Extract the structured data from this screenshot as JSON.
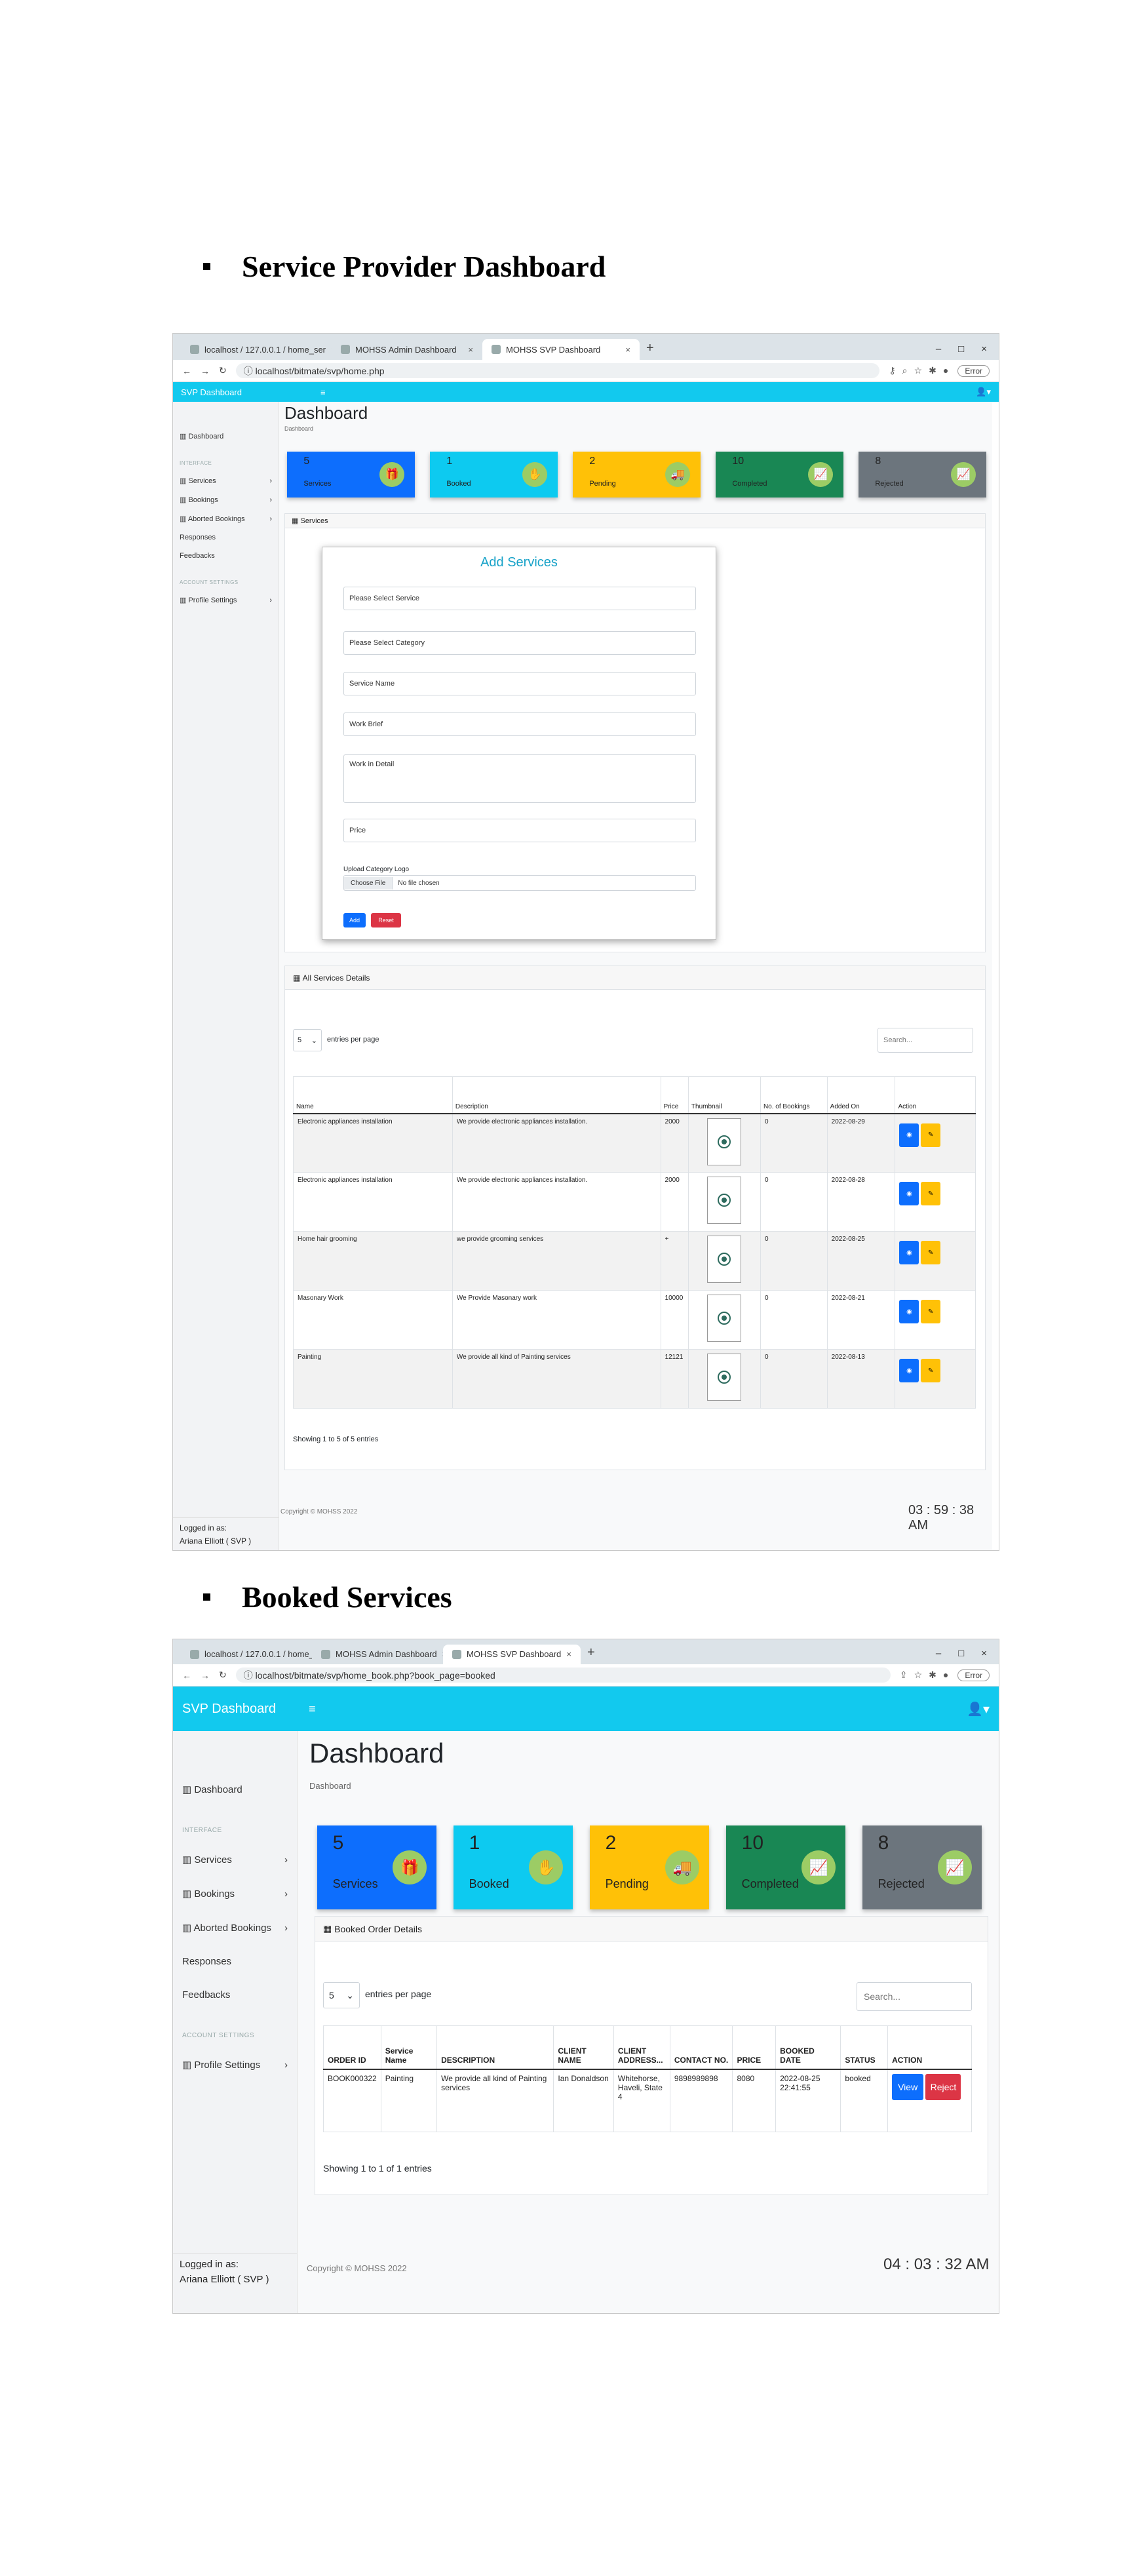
{
  "sections": [
    {
      "title": "Service Provider Dashboard"
    },
    {
      "title": "Booked Services"
    }
  ],
  "shot1": {
    "tabs": [
      "localhost / 127.0.0.1 / home_ser",
      "MOHSS Admin Dashboard",
      "MOHSS SVP Dashboard"
    ],
    "url": "localhost/bitmate/svp/home.php",
    "error_label": "Error",
    "brand": "SVP Dashboard",
    "menu_toggle": "≡",
    "user_icon": "person-icon",
    "sidebar": {
      "dashboard": "Dashboard",
      "interface_label": "INTERFACE",
      "items": [
        "Services",
        "Bookings",
        "Aborted Bookings",
        "Responses",
        "Feedbacks"
      ],
      "account_label": "ACCOUNT SETTINGS",
      "profile": "Profile Settings",
      "logged_in": "Logged in as:",
      "user": "Ariana Elliott ( SVP )"
    },
    "page_title": "Dashboard",
    "breadcrumb": "Dashboard",
    "cards": [
      {
        "num": "5",
        "label": "Services",
        "icon": "gift-icon",
        "color": "#0d6efd"
      },
      {
        "num": "1",
        "label": "Booked",
        "icon": "hand-coin-icon",
        "color": "#0dcaf0"
      },
      {
        "num": "2",
        "label": "Pending",
        "icon": "truck-icon",
        "color": "#ffc107"
      },
      {
        "num": "10",
        "label": "Completed",
        "icon": "chart-line-icon",
        "color": "#198754"
      },
      {
        "num": "8",
        "label": "Rejected",
        "icon": "chart-line-icon",
        "color": "#6c757d"
      }
    ],
    "services_panel_title": "Services",
    "form": {
      "title": "Add Services",
      "service_placeholder": "Please Select Service",
      "category_placeholder": "Please Select Category",
      "name_placeholder": "Service Name",
      "brief_placeholder": "Work Brief",
      "detail_placeholder": "Work in Detail",
      "price_placeholder": "Price",
      "logo_label": "Upload Category Logo",
      "choose_file": "Choose File",
      "no_file": "No file chosen",
      "add": "Add",
      "reset": "Reset"
    },
    "details_title": "All Services Details",
    "entries_value": "5",
    "entries_label": "entries per page",
    "search_placeholder": "Search...",
    "headers": [
      "Name",
      "Description",
      "Price",
      "Thumbnail",
      "No. of Bookings",
      "Added On",
      "Action"
    ],
    "rows": [
      {
        "name": "Electronic appliances installation",
        "desc": "We provide electronic appliances installation.",
        "price": "2000",
        "bookings": "0",
        "added": "2022-08-29"
      },
      {
        "name": "Electronic appliances installation",
        "desc": "We provide electronic appliances installation.",
        "price": "2000",
        "bookings": "0",
        "added": "2022-08-28"
      },
      {
        "name": "Home hair grooming",
        "desc": "we provide grooming services",
        "price": "+",
        "bookings": "0",
        "added": "2022-08-25"
      },
      {
        "name": "Masonary Work",
        "desc": "We Provide Masonary work",
        "price": "10000",
        "bookings": "0",
        "added": "2022-08-21"
      },
      {
        "name": "Painting",
        "desc": "We provide all kind of Painting services",
        "price": "12121",
        "bookings": "0",
        "added": "2022-08-13"
      }
    ],
    "showing": "Showing 1 to 5 of 5 entries",
    "copyright": "Copyright © MOHSS 2022",
    "clock": "03 : 59 : 38 AM"
  },
  "shot2": {
    "tabs": [
      "localhost / 127.0.0.1 / home_ser",
      "MOHSS Admin Dashboard",
      "MOHSS SVP Dashboard"
    ],
    "url": "localhost/bitmate/svp/home_book.php?book_page=booked",
    "error_label": "Error",
    "brand": "SVP Dashboard",
    "menu_toggle": "≡",
    "sidebar": {
      "dashboard": "Dashboard",
      "interface_label": "INTERFACE",
      "items": [
        "Services",
        "Bookings",
        "Aborted Bookings",
        "Responses",
        "Feedbacks"
      ],
      "account_label": "ACCOUNT SETTINGS",
      "profile": "Profile Settings",
      "logged_in": "Logged in as:",
      "user": "Ariana Elliott ( SVP )"
    },
    "page_title": "Dashboard",
    "breadcrumb": "Dashboard",
    "cards": [
      {
        "num": "5",
        "label": "Services",
        "icon": "gift-icon",
        "color": "#0d6efd"
      },
      {
        "num": "1",
        "label": "Booked",
        "icon": "hand-coin-icon",
        "color": "#0dcaf0"
      },
      {
        "num": "2",
        "label": "Pending",
        "icon": "truck-icon",
        "color": "#ffc107"
      },
      {
        "num": "10",
        "label": "Completed",
        "icon": "chart-line-icon",
        "color": "#198754"
      },
      {
        "num": "8",
        "label": "Rejected",
        "icon": "chart-line-icon",
        "color": "#6c757d"
      }
    ],
    "panel_title": "Booked Order Details",
    "entries_value": "5",
    "entries_label": "entries per page",
    "search_placeholder": "Search...",
    "headers": [
      "ORDER ID",
      "Service Name",
      "DESCRIPTION",
      "CLIENT NAME",
      "CLIENT ADDRESS...",
      "CONTACT NO.",
      "PRICE",
      "BOOKED DATE",
      "STATUS",
      "ACTION"
    ],
    "row": {
      "id": "BOOK000322",
      "service": "Painting",
      "desc": "We provide all kind of Painting services",
      "client": "Ian Donaldson",
      "address": "Whitehorse, Haveli, State 4",
      "contact": "9898989898",
      "price": "8080",
      "date": "2022-08-25 22:41:55",
      "status": "booked",
      "view": "View",
      "reject": "Reject"
    },
    "showing": "Showing 1 to 1 of 1 entries",
    "copyright": "Copyright © MOHSS 2022",
    "clock": "04 : 03 : 32 AM"
  }
}
